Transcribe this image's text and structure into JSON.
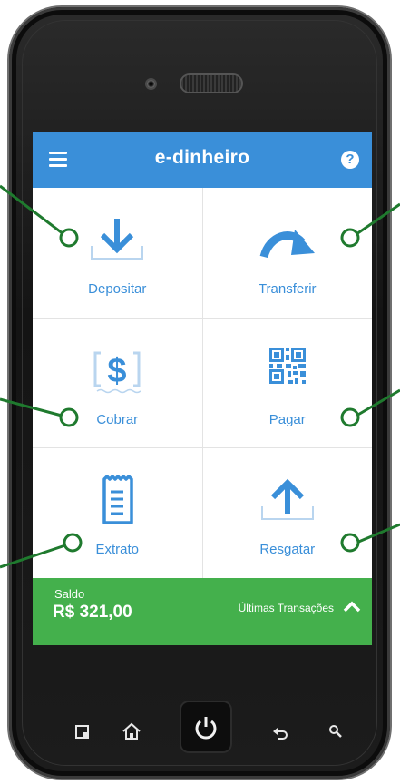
{
  "app": {
    "title": "e-dinheiro"
  },
  "header": {
    "menu_icon": "hamburger-menu-icon",
    "help_icon": "help-icon",
    "help_glyph": "?"
  },
  "tiles": [
    {
      "label": "Depositar",
      "icon": "download-tray-icon"
    },
    {
      "label": "Transferir",
      "icon": "curved-arrow-icon"
    },
    {
      "label": "Cobrar",
      "icon": "dollar-bill-icon"
    },
    {
      "label": "Pagar",
      "icon": "qr-code-icon"
    },
    {
      "label": "Extrato",
      "icon": "receipt-icon"
    },
    {
      "label": "Resgatar",
      "icon": "upload-tray-icon"
    }
  ],
  "footer": {
    "saldo_caption": "Saldo",
    "saldo_value": "R$ 321,00",
    "last_transactions": "Últimas Transações"
  },
  "colors": {
    "primary_blue": "#3a8fd9",
    "footer_green": "#44b04c",
    "callout_green": "#1f7a2e",
    "phone_body": "#1c1c1c"
  },
  "hardware_keys": [
    "recent-apps-icon",
    "home-icon",
    "power-icon",
    "back-icon",
    "search-icon"
  ]
}
